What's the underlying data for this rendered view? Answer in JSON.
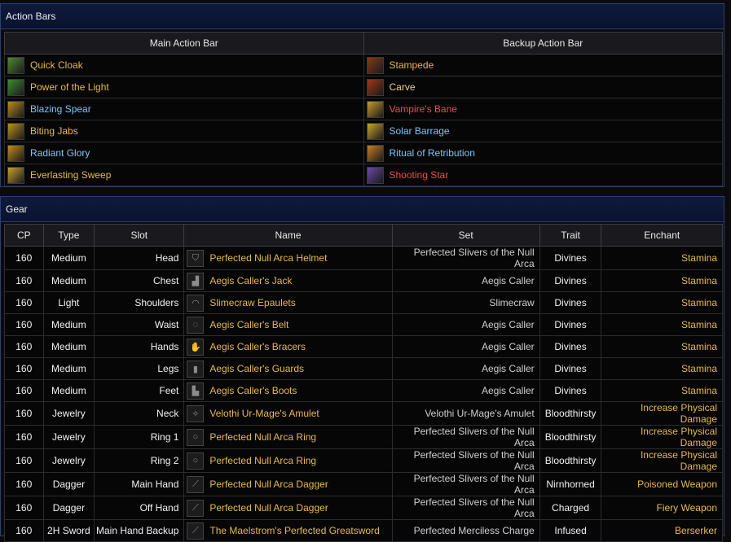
{
  "action_bars": {
    "title": "Action Bars",
    "main_header": "Main Action Bar",
    "backup_header": "Backup Action Bar",
    "rows": [
      {
        "main": {
          "name": "Quick Cloak",
          "color": "#e6b94d",
          "icon": "cloak-icon",
          "icon_bg": "#4f8a2e"
        },
        "backup": {
          "name": "Stampede",
          "color": "#e6b94d",
          "icon": "stampede-icon",
          "icon_bg": "#8a3a14"
        }
      },
      {
        "main": {
          "name": "Power of the Light",
          "color": "#e6b94d",
          "icon": "light-power-icon",
          "icon_bg": "#3f8a32"
        },
        "backup": {
          "name": "Carve",
          "color": "#f2d08a",
          "icon": "carve-icon",
          "icon_bg": "#a0361a"
        }
      },
      {
        "main": {
          "name": "Blazing Spear",
          "color": "#7ec6f5",
          "icon": "spear-icon",
          "icon_bg": "#b88a22"
        },
        "backup": {
          "name": "Vampire's Bane",
          "color": "#f04b4b",
          "icon": "vampire-bane-icon",
          "icon_bg": "#c79a2a"
        }
      },
      {
        "main": {
          "name": "Biting Jabs",
          "color": "#e6b94d",
          "icon": "jabs-icon",
          "icon_bg": "#b8921e"
        },
        "backup": {
          "name": "Solar Barrage",
          "color": "#7ec6f5",
          "icon": "solar-icon",
          "icon_bg": "#c9a42a"
        }
      },
      {
        "main": {
          "name": "Radiant Glory",
          "color": "#7ec6f5",
          "icon": "glory-icon",
          "icon_bg": "#c58a1e"
        },
        "backup": {
          "name": "Ritual of Retribution",
          "color": "#7ec6f5",
          "icon": "ritual-icon",
          "icon_bg": "#c77d22"
        }
      },
      {
        "main": {
          "name": "Everlasting Sweep",
          "color": "#e6b94d",
          "icon": "sweep-icon",
          "icon_bg": "#c9a030"
        },
        "backup": {
          "name": "Shooting Star",
          "color": "#f04b4b",
          "icon": "star-icon",
          "icon_bg": "#6a4aa8"
        }
      }
    ]
  },
  "gear": {
    "title": "Gear",
    "headers": {
      "cp": "CP",
      "type": "Type",
      "slot": "Slot",
      "name": "Name",
      "set": "Set",
      "trait": "Trait",
      "enchant": "Enchant"
    },
    "rows": [
      {
        "cp": "160",
        "type": "Medium",
        "slot": "Head",
        "name": "Perfected Null Arca Helmet",
        "set": "Perfected Slivers of the Null Arca",
        "trait": "Divines",
        "enchant": "Stamina",
        "icon": "helmet-icon",
        "glyph": "⛉"
      },
      {
        "cp": "160",
        "type": "Medium",
        "slot": "Chest",
        "name": "Aegis Caller's Jack",
        "set": "Aegis Caller",
        "trait": "Divines",
        "enchant": "Stamina",
        "icon": "chest-armor-icon",
        "glyph": "▟"
      },
      {
        "cp": "160",
        "type": "Light",
        "slot": "Shoulders",
        "name": "Slimecraw Epaulets",
        "set": "Slimecraw",
        "trait": "Divines",
        "enchant": "Stamina",
        "icon": "shoulders-icon",
        "glyph": "◠"
      },
      {
        "cp": "160",
        "type": "Medium",
        "slot": "Waist",
        "name": "Aegis Caller's Belt",
        "set": "Aegis Caller",
        "trait": "Divines",
        "enchant": "Stamina",
        "icon": "belt-icon",
        "glyph": "◌"
      },
      {
        "cp": "160",
        "type": "Medium",
        "slot": "Hands",
        "name": "Aegis Caller's Bracers",
        "set": "Aegis Caller",
        "trait": "Divines",
        "enchant": "Stamina",
        "icon": "bracers-icon",
        "glyph": "✋"
      },
      {
        "cp": "160",
        "type": "Medium",
        "slot": "Legs",
        "name": "Aegis Caller's Guards",
        "set": "Aegis Caller",
        "trait": "Divines",
        "enchant": "Stamina",
        "icon": "legs-icon",
        "glyph": "▮"
      },
      {
        "cp": "160",
        "type": "Medium",
        "slot": "Feet",
        "name": "Aegis Caller's Boots",
        "set": "Aegis Caller",
        "trait": "Divines",
        "enchant": "Stamina",
        "icon": "boots-icon",
        "glyph": "▙"
      },
      {
        "cp": "160",
        "type": "Jewelry",
        "slot": "Neck",
        "name": "Velothi Ur-Mage's Amulet",
        "set": "Velothi Ur-Mage's Amulet",
        "trait": "Bloodthirsty",
        "enchant": "Increase Physical Damage",
        "icon": "amulet-icon",
        "glyph": "✧"
      },
      {
        "cp": "160",
        "type": "Jewelry",
        "slot": "Ring 1",
        "name": "Perfected Null Arca Ring",
        "set": "Perfected Slivers of the Null Arca",
        "trait": "Bloodthirsty",
        "enchant": "Increase Physical Damage",
        "icon": "ring-icon",
        "glyph": "○"
      },
      {
        "cp": "160",
        "type": "Jewelry",
        "slot": "Ring 2",
        "name": "Perfected Null Arca Ring",
        "set": "Perfected Slivers of the Null Arca",
        "trait": "Bloodthirsty",
        "enchant": "Increase Physical Damage",
        "icon": "ring-icon",
        "glyph": "○"
      },
      {
        "cp": "160",
        "type": "Dagger",
        "slot": "Main Hand",
        "name": "Perfected Null Arca Dagger",
        "set": "Perfected Slivers of the Null Arca",
        "trait": "Nirnhorned",
        "enchant": "Poisoned Weapon",
        "icon": "dagger-icon",
        "glyph": "⟋"
      },
      {
        "cp": "160",
        "type": "Dagger",
        "slot": "Off Hand",
        "name": "Perfected Null Arca Dagger",
        "set": "Perfected Slivers of the Null Arca",
        "trait": "Charged",
        "enchant": "Fiery Weapon",
        "icon": "dagger-icon",
        "glyph": "⟋"
      },
      {
        "cp": "160",
        "type": "2H Sword",
        "slot": "Main Hand Backup",
        "name": "The Maelstrom's Perfected Greatsword",
        "set": "Perfected Merciless Charge",
        "trait": "Infused",
        "enchant": "Berserker",
        "icon": "greatsword-icon",
        "glyph": "⟋"
      }
    ]
  }
}
